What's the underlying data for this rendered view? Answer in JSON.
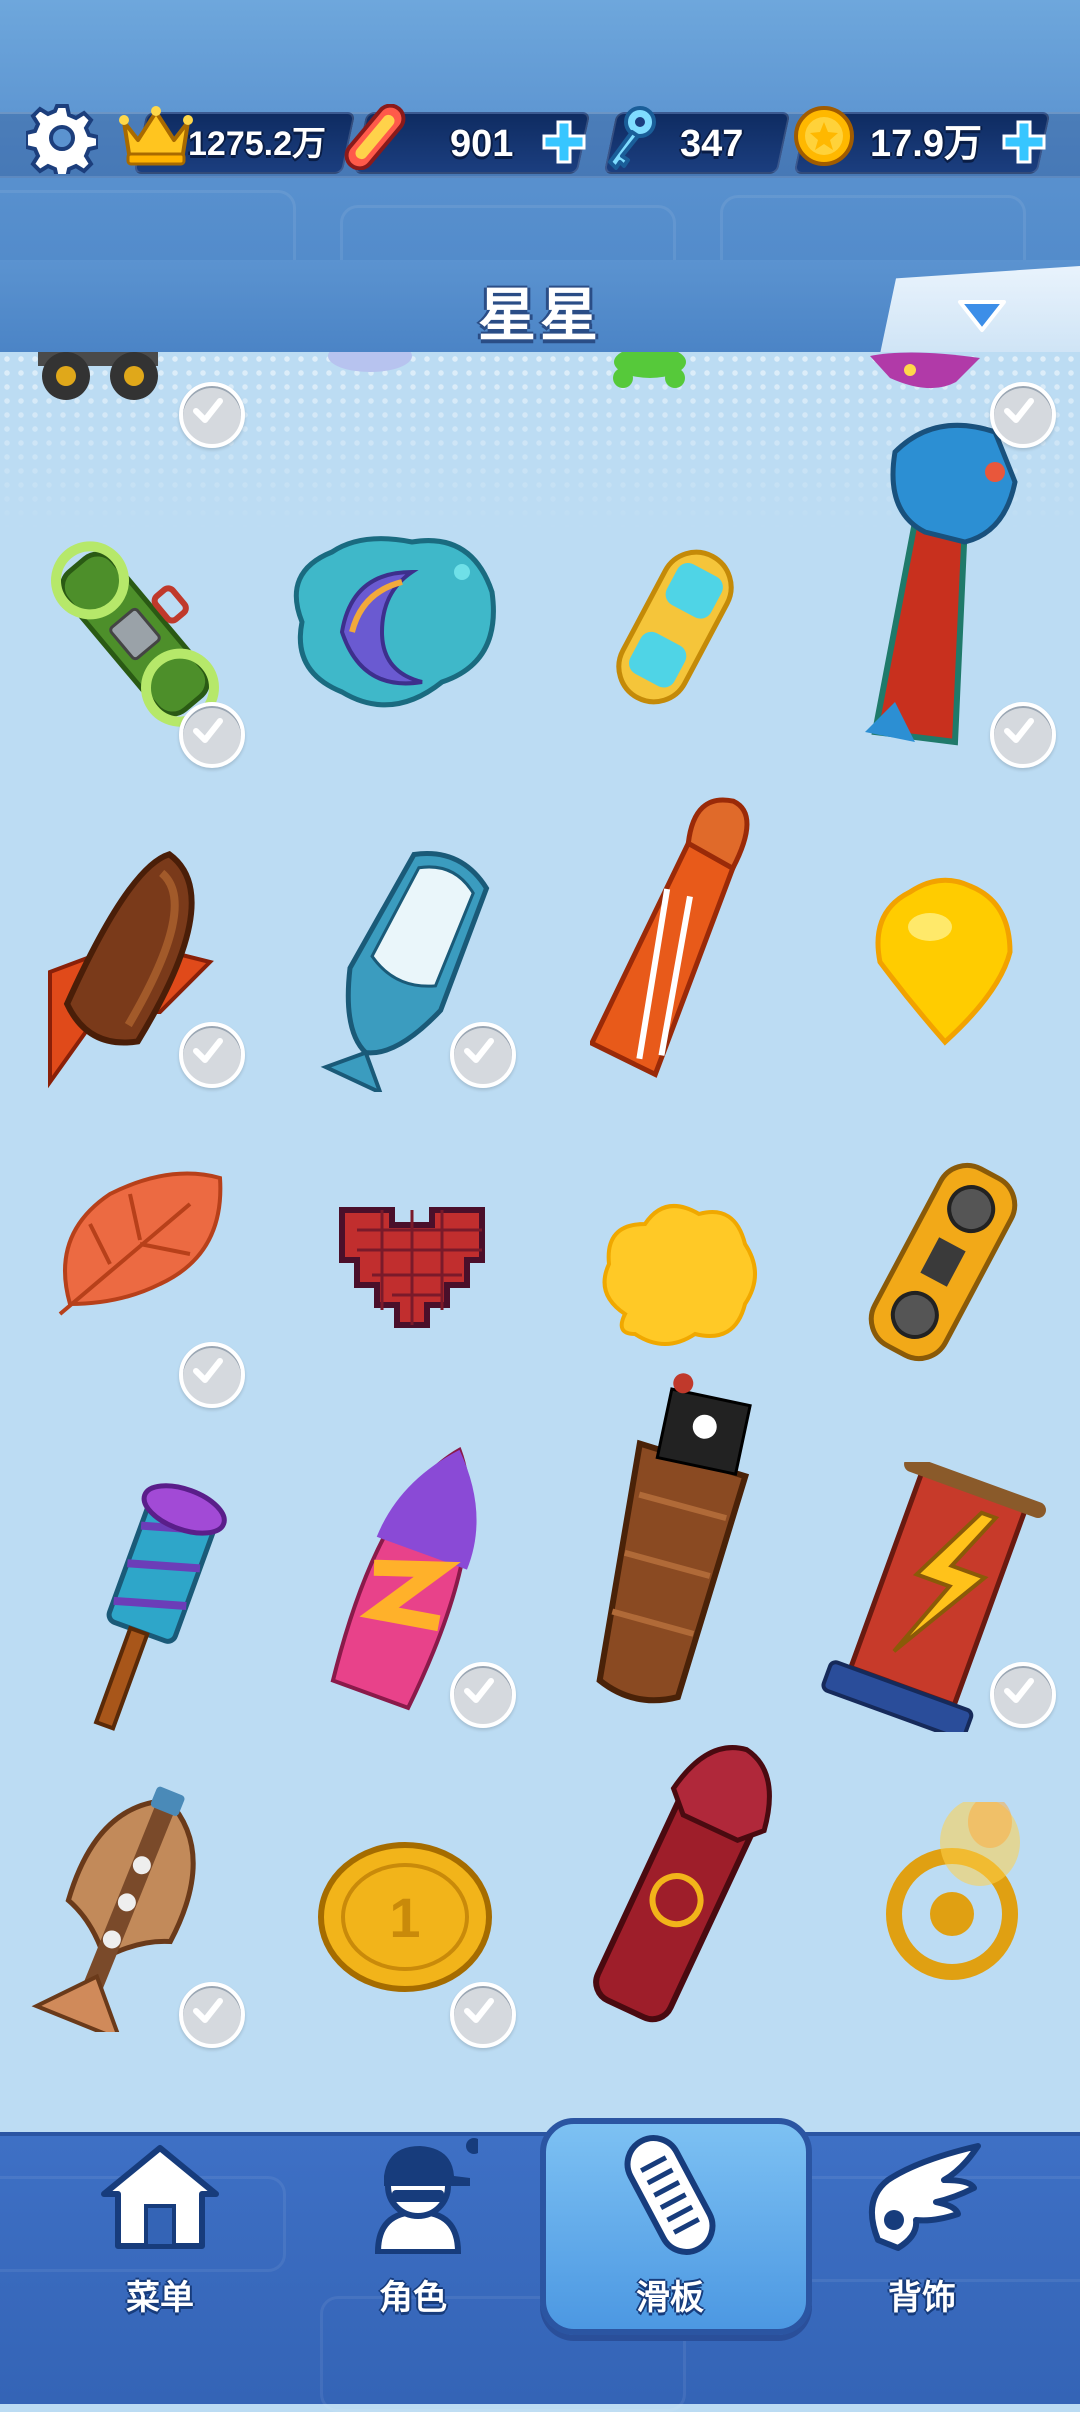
{
  "header": {
    "stats": [
      {
        "icon": "crown-icon",
        "value": "1275.2万",
        "has_plus": false
      },
      {
        "icon": "skateboard-token-icon",
        "value": "901",
        "has_plus": true
      },
      {
        "icon": "key-icon",
        "value": "347",
        "has_plus": false
      },
      {
        "icon": "coin-icon",
        "value": "17.9万",
        "has_plus": true
      }
    ],
    "category_title": "星星"
  },
  "items": [
    {
      "name": "monster-truck-board",
      "owned": true
    },
    {
      "name": "cloud-board-partial",
      "owned": false
    },
    {
      "name": "green-frog-board",
      "owned": false
    },
    {
      "name": "purple-creature-board",
      "owned": true
    },
    {
      "name": "green-hover-board",
      "owned": true
    },
    {
      "name": "moon-fish-board",
      "owned": false
    },
    {
      "name": "yellow-cyan-board",
      "owned": false
    },
    {
      "name": "dragon-board",
      "owned": true
    },
    {
      "name": "wing-boat-board",
      "owned": true
    },
    {
      "name": "whale-board",
      "owned": true
    },
    {
      "name": "fire-horse-board",
      "owned": false
    },
    {
      "name": "yellow-flame-board",
      "owned": false
    },
    {
      "name": "leaf-board",
      "owned": true
    },
    {
      "name": "pixel-heart-board",
      "owned": false
    },
    {
      "name": "yellow-cloud-board",
      "owned": false
    },
    {
      "name": "boombox-board",
      "owned": false
    },
    {
      "name": "firework-rocket-board",
      "owned": false
    },
    {
      "name": "surf-board",
      "owned": true
    },
    {
      "name": "pirate-ship-board",
      "owned": false
    },
    {
      "name": "lightning-scroll-board",
      "owned": true
    },
    {
      "name": "kite-board",
      "owned": true
    },
    {
      "name": "gold-coin-board",
      "owned": true
    },
    {
      "name": "red-wolf-board",
      "owned": false
    },
    {
      "name": "golden-ring-board",
      "owned": false
    }
  ],
  "nav": [
    {
      "label": "菜单",
      "icon": "home-icon",
      "active": false
    },
    {
      "label": "角色",
      "icon": "character-icon",
      "active": false
    },
    {
      "label": "滑板",
      "icon": "skateboard-icon",
      "active": true
    },
    {
      "label": "背饰",
      "icon": "wing-icon",
      "active": false
    }
  ]
}
